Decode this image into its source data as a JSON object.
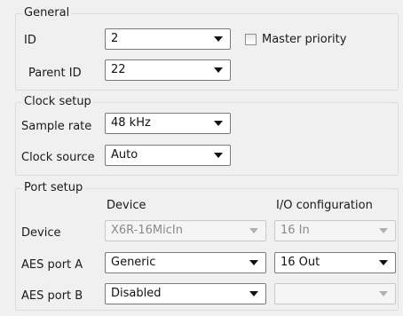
{
  "general": {
    "title": "General",
    "id_label": "ID",
    "id_value": "2",
    "master_priority_label": "Master priority",
    "master_priority_checked": false,
    "parent_id_label": "Parent ID",
    "parent_id_value": "22"
  },
  "clock": {
    "title": "Clock setup",
    "sample_rate_label": "Sample rate",
    "sample_rate_value": "48 kHz",
    "clock_source_label": "Clock source",
    "clock_source_value": "Auto"
  },
  "port": {
    "title": "Port setup",
    "col_device": "Device",
    "col_io": "I/O configuration",
    "rows": [
      {
        "label": "Device",
        "device": "X6R-16MicIn",
        "io": "16 In",
        "device_enabled": false,
        "io_enabled": false
      },
      {
        "label": "AES port A",
        "device": "Generic",
        "io": "16 Out",
        "device_enabled": true,
        "io_enabled": true
      },
      {
        "label": "AES port B",
        "device": "Disabled",
        "io": "",
        "device_enabled": true,
        "io_enabled": false
      }
    ]
  },
  "icons": {
    "dropdown": "chevron-down-icon"
  }
}
